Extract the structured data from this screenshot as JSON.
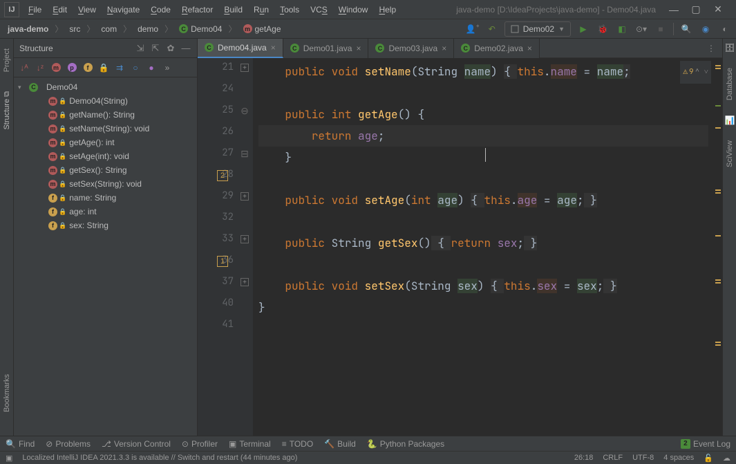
{
  "title": "java-demo [D:\\IdeaProjects\\java-demo] - Demo04.java",
  "menu": [
    "File",
    "Edit",
    "View",
    "Navigate",
    "Code",
    "Refactor",
    "Build",
    "Run",
    "Tools",
    "VCS",
    "Window",
    "Help"
  ],
  "breadcrumb": {
    "project": "java-demo",
    "src": "src",
    "pkg1": "com",
    "pkg2": "demo",
    "cls": "Demo04",
    "member": "getAge"
  },
  "run_config": "Demo02",
  "structure": {
    "title": "Structure",
    "root": "Demo04",
    "items": [
      {
        "icon": "m",
        "label": "Demo04(String)"
      },
      {
        "icon": "m",
        "label": "getName(): String"
      },
      {
        "icon": "m",
        "label": "setName(String): void"
      },
      {
        "icon": "m",
        "label": "getAge(): int"
      },
      {
        "icon": "m",
        "label": "setAge(int): void"
      },
      {
        "icon": "m",
        "label": "getSex(): String"
      },
      {
        "icon": "m",
        "label": "setSex(String): void"
      },
      {
        "icon": "f",
        "label": "name: String"
      },
      {
        "icon": "f",
        "label": "age: int"
      },
      {
        "icon": "f",
        "label": "sex: String"
      }
    ]
  },
  "tabs": [
    {
      "label": "Demo04.java",
      "active": true
    },
    {
      "label": "Demo01.java",
      "active": false
    },
    {
      "label": "Demo03.java",
      "active": false
    },
    {
      "label": "Demo02.java",
      "active": false
    }
  ],
  "problems": {
    "warnings": 9
  },
  "gutter": [
    "21",
    "24",
    "25",
    "26",
    "27",
    "28",
    "29",
    "32",
    "33",
    "36",
    "37",
    "40",
    "41"
  ],
  "bottom": {
    "find": "Find",
    "problems": "Problems",
    "vcs": "Version Control",
    "profiler": "Profiler",
    "terminal": "Terminal",
    "todo": "TODO",
    "build": "Build",
    "pypkg": "Python Packages",
    "eventlog": "Event Log",
    "ev_count": "2"
  },
  "status": {
    "msg": "Localized IntelliJ IDEA 2021.3.3 is available // Switch and restart (44 minutes ago)",
    "pos": "26:18",
    "eol": "CRLF",
    "enc": "UTF-8",
    "indent": "4 spaces"
  },
  "right_rail": [
    "Database",
    "SciView"
  ]
}
